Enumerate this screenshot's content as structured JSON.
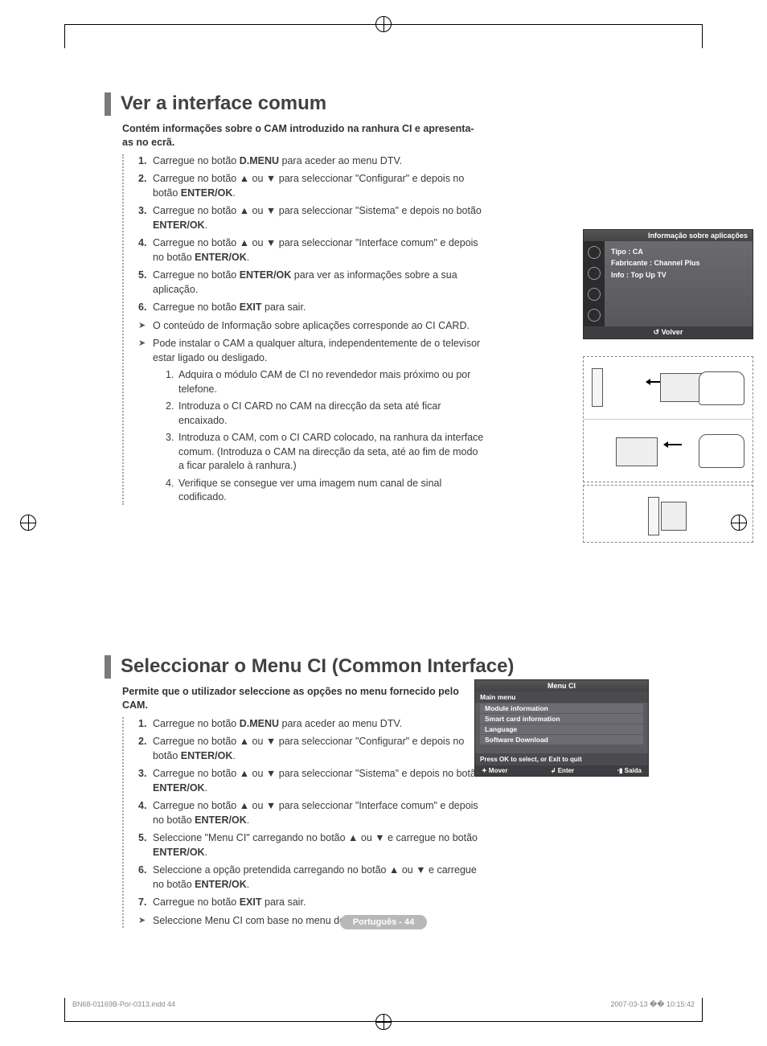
{
  "section1": {
    "title": "Ver a interface comum",
    "intro": "Contém informações sobre o CAM introduzido na ranhura CI e apresenta-as no ecrã.",
    "steps": [
      {
        "n": "1.",
        "html": "Carregue no botão <b>D.MENU</b> para aceder ao menu DTV."
      },
      {
        "n": "2.",
        "html": "Carregue no botão ▲ ou ▼ para seleccionar \"Configurar\" e depois no botão <b>ENTER/OK</b>."
      },
      {
        "n": "3.",
        "html": "Carregue no botão ▲ ou ▼ para seleccionar \"Sistema\" e depois no botão <b>ENTER/OK</b>."
      },
      {
        "n": "4.",
        "html": "Carregue no botão ▲ ou ▼ para seleccionar \"Interface comum\" e depois no botão <b>ENTER/OK</b>."
      },
      {
        "n": "5.",
        "html": "Carregue no botão <b>ENTER/OK</b> para ver as informações sobre a sua aplicação."
      },
      {
        "n": "6.",
        "html": "Carregue no botão <b>EXIT</b> para sair."
      }
    ],
    "notes": [
      "O conteúdo de Informação sobre aplicações corresponde ao CI CARD.",
      "Pode instalar o CAM a qualquer altura, independentemente de o televisor estar ligado ou desligado."
    ],
    "substeps": [
      {
        "n": "1.",
        "text": "Adquira o módulo CAM de CI no revendedor mais próximo ou por telefone."
      },
      {
        "n": "2.",
        "text": "Introduza o CI CARD no CAM na direcção da seta até ficar encaixado."
      },
      {
        "n": "3.",
        "text": "Introduza o CAM, com o CI CARD colocado, na ranhura da interface comum. (Introduza o CAM na direcção da seta, até ao fim de modo a ficar paralelo à ranhura.)"
      },
      {
        "n": "4.",
        "text": "Verifique se consegue ver uma imagem num canal de sinal codificado."
      }
    ]
  },
  "osd1": {
    "title": "Informação sobre aplicações",
    "line1": "Tipo : CA",
    "line2": "Fabricante : Channel Plus",
    "line3": "Info : Top Up TV",
    "footer": "↺ Volver"
  },
  "section2": {
    "title": "Seleccionar o Menu CI (Common Interface)",
    "intro": "Permite que o utilizador seleccione as opções no menu fornecido pelo CAM.",
    "steps": [
      {
        "n": "1.",
        "html": "Carregue no botão <b>D.MENU</b> para aceder ao menu DTV."
      },
      {
        "n": "2.",
        "html": "Carregue no botão ▲ ou ▼ para seleccionar \"Configurar\" e depois no botão <b>ENTER/OK</b>."
      },
      {
        "n": "3.",
        "html": "Carregue no botão ▲ ou ▼ para seleccionar \"Sistema\" e depois no botão <b>ENTER/OK</b>."
      },
      {
        "n": "4.",
        "html": "Carregue no botão ▲ ou ▼ para seleccionar \"Interface comum\" e depois no botão <b>ENTER/OK</b>."
      },
      {
        "n": "5.",
        "html": "Seleccione \"Menu CI\" carregando no botão ▲ ou ▼ e carregue no botão <b>ENTER/OK</b>."
      },
      {
        "n": "6.",
        "html": "Seleccione a opção pretendida carregando no botão ▲ ou ▼ e carregue no botão <b>ENTER/OK</b>."
      },
      {
        "n": "7.",
        "html": "Carregue no botão <b>EXIT</b> para sair."
      }
    ],
    "note": "Seleccione Menu CI com base no menu do CI Card."
  },
  "osd2": {
    "title": "Menu CI",
    "mainmenu": "Main menu",
    "items": [
      "Module information",
      "Smart card information",
      "Language",
      "Software Download"
    ],
    "hint": "Press OK to select, or Exit to quit",
    "footer": {
      "move": "✦ Mover",
      "enter": "↲ Enter",
      "exit": "⋅▮ Saída"
    }
  },
  "footer": {
    "page": "Português - 44",
    "imprint_left": "BN68-01169B-Por-0313.indd   44",
    "imprint_right": "2007-03-13   �� 10:15:42"
  }
}
